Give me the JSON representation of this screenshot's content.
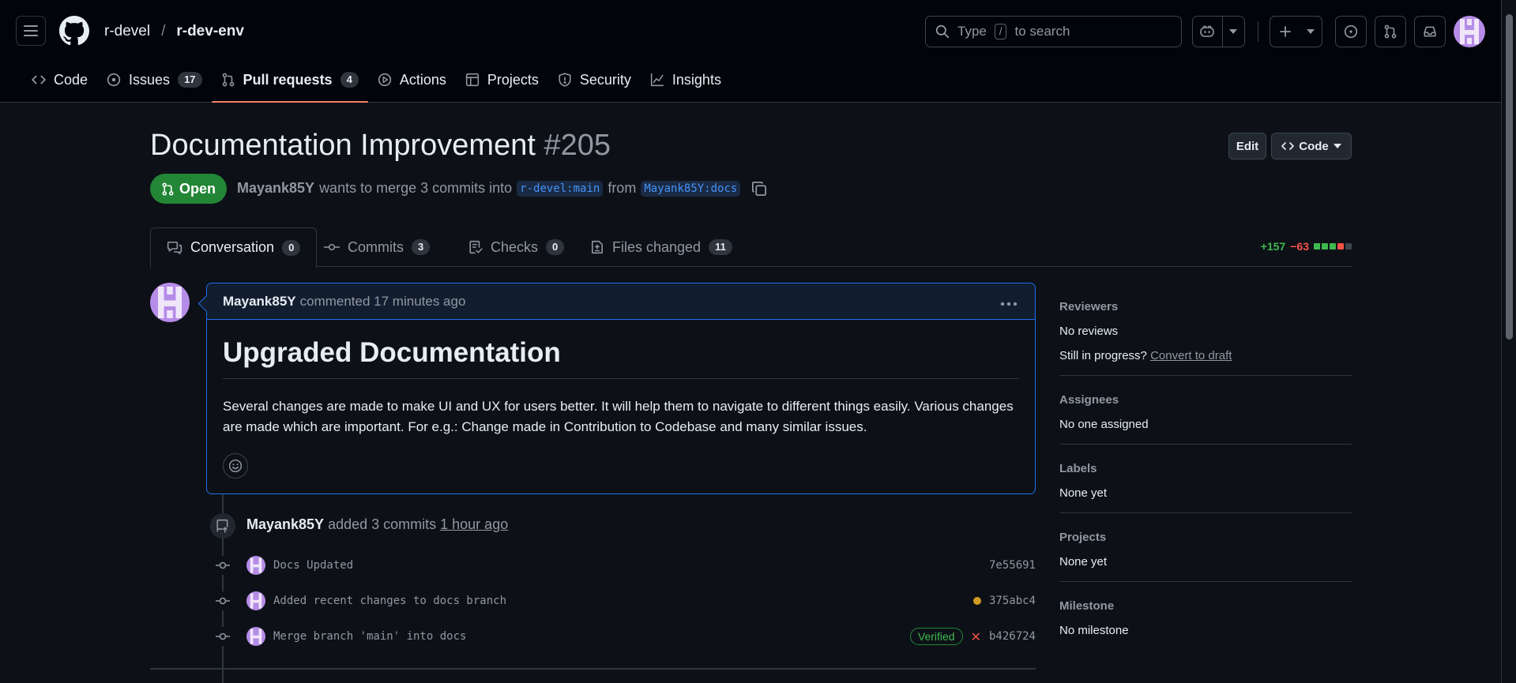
{
  "header": {
    "owner": "r-devel",
    "separator": "/",
    "repo": "r-dev-env",
    "search": {
      "prefix": "Type",
      "key": "/",
      "suffix": "to search"
    }
  },
  "nav": {
    "code": "Code",
    "issues": "Issues",
    "issues_count": "17",
    "pulls": "Pull requests",
    "pulls_count": "4",
    "actions": "Actions",
    "projects": "Projects",
    "security": "Security",
    "insights": "Insights"
  },
  "pr": {
    "title": "Documentation Improvement",
    "number": "#205",
    "edit_label": "Edit",
    "code_label": "Code",
    "state": "Open",
    "author": "Mayank85Y",
    "meta_text": "wants to merge 3 commits into",
    "base_branch": "r-devel:main",
    "from_text": "from",
    "head_branch": "Mayank85Y:docs"
  },
  "tabs": {
    "conversation": "Conversation",
    "conversation_count": "0",
    "commits": "Commits",
    "commits_count": "3",
    "checks": "Checks",
    "checks_count": "0",
    "files": "Files changed",
    "files_count": "11",
    "additions": "+157",
    "deletions": "−63"
  },
  "comment": {
    "author": "Mayank85Y",
    "action": "commented 17 minutes ago",
    "heading": "Upgraded Documentation",
    "body": "Several changes are made to make UI and UX for users better. It will help them to navigate to different things easily. Various changes are made which are important. For e.g.: Change made in Contribution to Codebase and many similar issues."
  },
  "timeline": {
    "author": "Mayank85Y",
    "action": "added 3 commits",
    "time": "1 hour ago",
    "commits": [
      {
        "message": "Docs Updated",
        "sha": "7e55691"
      },
      {
        "message": "Added recent changes to docs branch",
        "sha": "375abc4"
      },
      {
        "message": "Merge branch 'main' into docs",
        "sha": "b426724",
        "badge": "Verified"
      }
    ]
  },
  "sidebar": {
    "reviewers_title": "Reviewers",
    "reviewers_value": "No reviews",
    "draft_prompt": "Still in progress?",
    "draft_link": "Convert to draft",
    "assignees_title": "Assignees",
    "assignees_value": "No one assigned",
    "labels_title": "Labels",
    "labels_value": "None yet",
    "projects_title": "Projects",
    "projects_value": "None yet",
    "milestone_title": "Milestone",
    "milestone_value": "No milestone"
  },
  "colors": {
    "background": "#0d1117",
    "header_bg": "#010409",
    "accent_blue": "#1f6feb",
    "open_green": "#238636",
    "active_tab": "#f78166",
    "addition": "#3fb950",
    "deletion": "#f85149",
    "pending": "#d29922"
  },
  "icons": [
    "hamburger-icon",
    "github-logo-icon",
    "search-icon",
    "copilot-icon",
    "plus-icon",
    "issue-icon",
    "pull-request-icon",
    "inbox-icon",
    "code-icon",
    "play-icon",
    "table-icon",
    "shield-icon",
    "graph-icon",
    "copy-icon",
    "comment-icon",
    "commit-icon",
    "checklist-icon",
    "file-diff-icon",
    "kebab-icon",
    "smiley-icon",
    "repo-push-icon",
    "x-icon"
  ]
}
